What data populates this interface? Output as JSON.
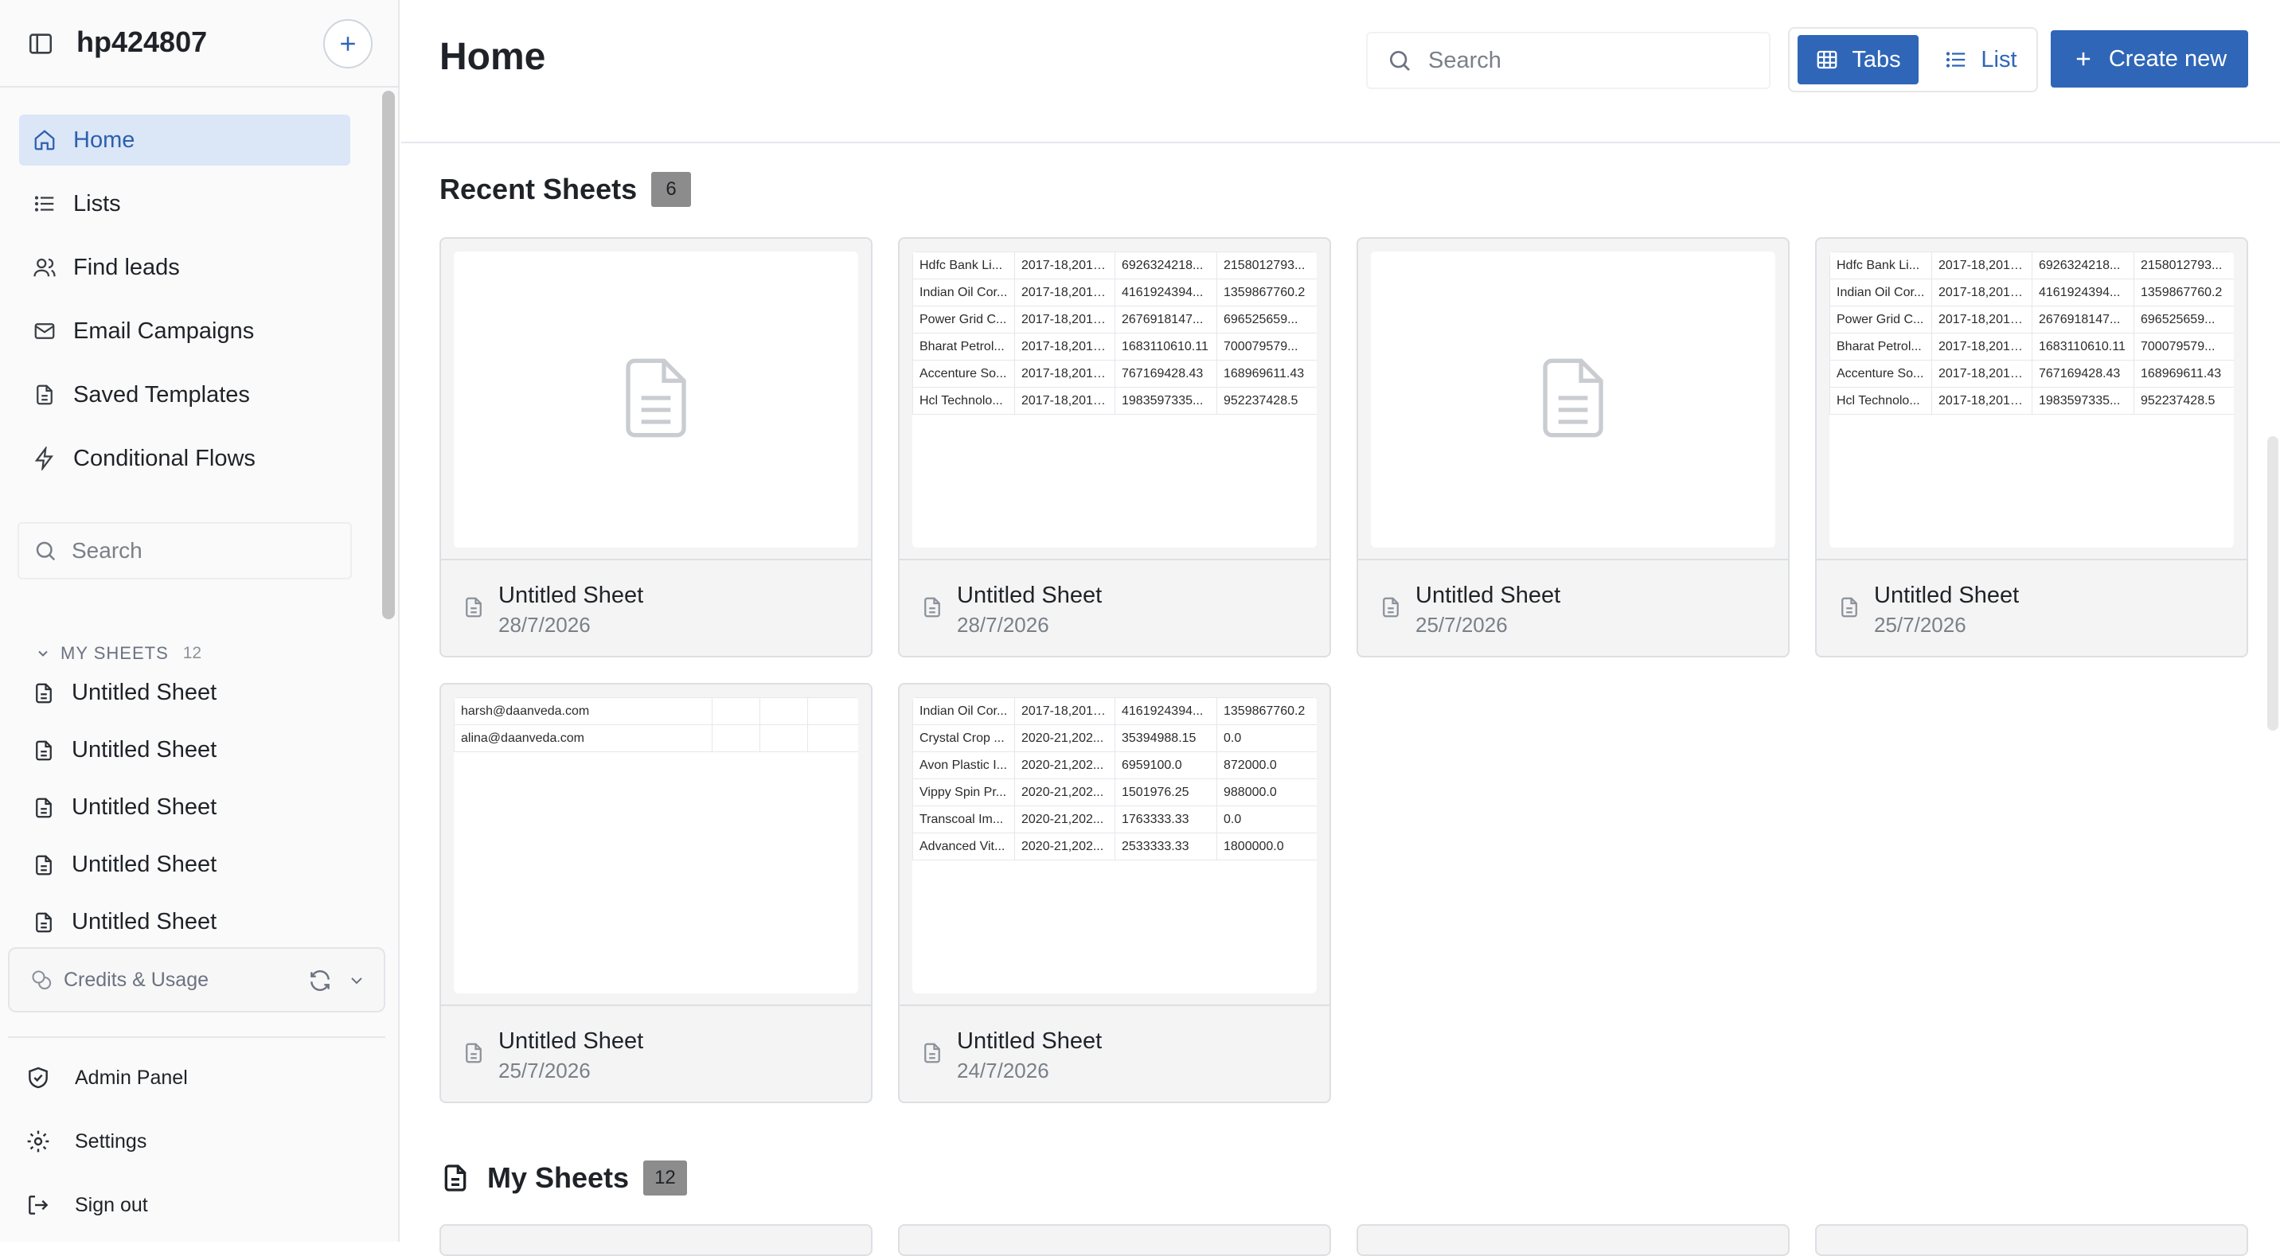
{
  "workspace": {
    "name": "hp424807"
  },
  "sidebar": {
    "nav": [
      {
        "label": "Home",
        "icon": "home-icon",
        "active": true
      },
      {
        "label": "Lists",
        "icon": "list-icon"
      },
      {
        "label": "Find leads",
        "icon": "users-icon"
      },
      {
        "label": "Email Campaigns",
        "icon": "mail-icon"
      },
      {
        "label": "Saved Templates",
        "icon": "document-icon"
      },
      {
        "label": "Conditional Flows",
        "icon": "lightning-icon"
      }
    ],
    "search_placeholder": "Search",
    "my_sheets": {
      "title": "MY SHEETS",
      "count": "12",
      "items": [
        "Untitled Sheet",
        "Untitled Sheet",
        "Untitled Sheet",
        "Untitled Sheet",
        "Untitled Sheet"
      ]
    },
    "credits_label": "Credits & Usage",
    "bottom": [
      {
        "label": "Admin Panel",
        "icon": "shield-check-icon"
      },
      {
        "label": "Settings",
        "icon": "gear-icon"
      },
      {
        "label": "Sign out",
        "icon": "sign-out-icon"
      }
    ]
  },
  "header": {
    "title": "Home",
    "search_placeholder": "Search",
    "view_tabs_label": "Tabs",
    "view_list_label": "List",
    "create_label": "Create new"
  },
  "recent": {
    "title": "Recent Sheets",
    "count": "6",
    "cards": [
      {
        "name": "Untitled Sheet",
        "date": "28/7/2026",
        "preview": "empty"
      },
      {
        "name": "Untitled Sheet",
        "date": "28/7/2026",
        "preview": "table",
        "rows": [
          [
            "Hdfc Bank Li...",
            "2017-18,2018...",
            "6926324218...",
            "2158012793..."
          ],
          [
            "Indian Oil Cor...",
            "2017-18,2018...",
            "4161924394...",
            "1359867760.2"
          ],
          [
            "Power Grid C...",
            "2017-18,2018...",
            "2676918147...",
            "696525659..."
          ],
          [
            "Bharat Petrol...",
            "2017-18,2018...",
            "1683110610.11",
            "700079579..."
          ],
          [
            "Accenture So...",
            "2017-18,2018...",
            "767169428.43",
            "168969611.43"
          ],
          [
            "Hcl Technolo...",
            "2017-18,2018...",
            "1983597335...",
            "952237428.5"
          ]
        ]
      },
      {
        "name": "Untitled Sheet",
        "date": "25/7/2026",
        "preview": "empty"
      },
      {
        "name": "Untitled Sheet",
        "date": "25/7/2026",
        "preview": "table",
        "rows": [
          [
            "Hdfc Bank Li...",
            "2017-18,2018...",
            "6926324218...",
            "2158012793..."
          ],
          [
            "Indian Oil Cor...",
            "2017-18,2018...",
            "4161924394...",
            "1359867760.2"
          ],
          [
            "Power Grid C...",
            "2017-18,2018...",
            "2676918147...",
            "696525659..."
          ],
          [
            "Bharat Petrol...",
            "2017-18,2018...",
            "1683110610.11",
            "700079579..."
          ],
          [
            "Accenture So...",
            "2017-18,2018...",
            "767169428.43",
            "168969611.43"
          ],
          [
            "Hcl Technolo...",
            "2017-18,2018...",
            "1983597335...",
            "952237428.5"
          ]
        ]
      },
      {
        "name": "Untitled Sheet",
        "date": "25/7/2026",
        "preview": "emails",
        "rows": [
          [
            "harsh@daanveda.com",
            "",
            "",
            ""
          ],
          [
            "alina@daanveda.com",
            "",
            "",
            ""
          ]
        ]
      },
      {
        "name": "Untitled Sheet",
        "date": "24/7/2026",
        "preview": "table",
        "rows": [
          [
            "Indian Oil Cor...",
            "2017-18,2018...",
            "4161924394...",
            "1359867760.2"
          ],
          [
            "Crystal Crop ...",
            "2020-21,202...",
            "35394988.15",
            "0.0"
          ],
          [
            "Avon Plastic I...",
            "2020-21,202...",
            "6959100.0",
            "872000.0"
          ],
          [
            "Vippy Spin Pr...",
            "2020-21,202...",
            "1501976.25",
            "988000.0"
          ],
          [
            "Transcoal Im...",
            "2020-21,202...",
            "1763333.33",
            "0.0"
          ],
          [
            "Advanced Vit...",
            "2020-21,202...",
            "2533333.33",
            "1800000.0"
          ]
        ]
      }
    ]
  },
  "my_sheets_section": {
    "title": "My Sheets",
    "count": "12"
  },
  "colors": {
    "accent": "#2f66b8",
    "active_nav_bg": "#dbe6f7",
    "badge_bg": "#8c8c8c"
  }
}
